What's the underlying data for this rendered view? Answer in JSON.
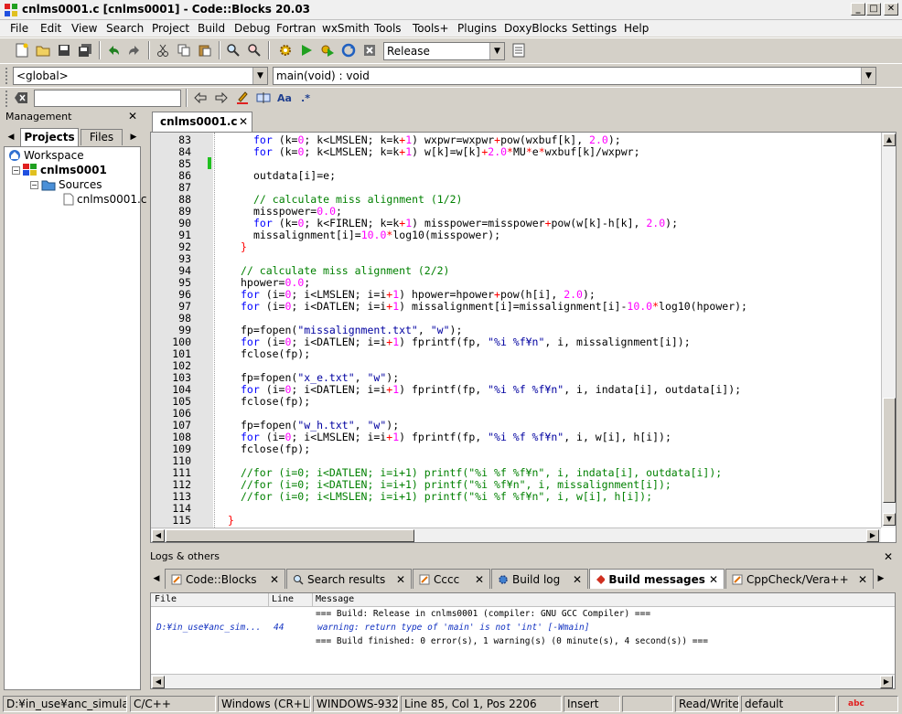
{
  "window": {
    "title": "cnlms0001.c [cnlms0001] - Code::Blocks 20.03",
    "min_glyph": "_",
    "max_glyph": "□",
    "close_glyph": "✕"
  },
  "menu": [
    "File",
    "Edit",
    "View",
    "Search",
    "Project",
    "Build",
    "Debug",
    "Fortran",
    "wxSmith",
    "Tools",
    "Tools+",
    "Plugins",
    "DoxyBlocks",
    "Settings",
    "Help"
  ],
  "toolbar": {
    "build_target": "Release",
    "scope": "<global>",
    "function": "main(void) : void",
    "search_value": ""
  },
  "management": {
    "title": "Management",
    "tabs": [
      "Projects",
      "Files"
    ],
    "tree": {
      "workspace": "Workspace",
      "project": "cnlms0001",
      "folder": "Sources",
      "file": "cnlms0001.c"
    }
  },
  "editor": {
    "tab": "cnlms0001.c",
    "lines": [
      {
        "n": "83",
        "indent": 2,
        "parts": [
          [
            "kw",
            "for"
          ],
          [
            "t",
            " (k="
          ],
          [
            "num",
            "0"
          ],
          [
            "t",
            "; k<LMSLEN; k=k"
          ],
          [
            "op",
            "+"
          ],
          [
            "num",
            "1"
          ],
          [
            "t",
            ") wxpwr=wxpwr"
          ],
          [
            "op",
            "+"
          ],
          [
            "t",
            "pow(wxbuf[k], "
          ],
          [
            "num",
            "2.0"
          ],
          [
            "t",
            ");"
          ]
        ]
      },
      {
        "n": "84",
        "indent": 2,
        "parts": [
          [
            "kw",
            "for"
          ],
          [
            "t",
            " (k="
          ],
          [
            "num",
            "0"
          ],
          [
            "t",
            "; k<LMSLEN; k=k"
          ],
          [
            "op",
            "+"
          ],
          [
            "num",
            "1"
          ],
          [
            "t",
            ") w[k]=w[k]"
          ],
          [
            "op",
            "+"
          ],
          [
            "num",
            "2.0"
          ],
          [
            "op",
            "*"
          ],
          [
            "t",
            "MU"
          ],
          [
            "op",
            "*"
          ],
          [
            "t",
            "e"
          ],
          [
            "op",
            "*"
          ],
          [
            "t",
            "wxbuf[k]/wxpwr;"
          ]
        ]
      },
      {
        "n": "85",
        "indent": 2,
        "parts": []
      },
      {
        "n": "86",
        "indent": 2,
        "parts": [
          [
            "t",
            "outdata[i]=e;"
          ]
        ]
      },
      {
        "n": "87",
        "indent": 2,
        "parts": []
      },
      {
        "n": "88",
        "indent": 2,
        "parts": [
          [
            "cm",
            "// calculate miss alignment (1/2)"
          ]
        ]
      },
      {
        "n": "89",
        "indent": 2,
        "parts": [
          [
            "t",
            "misspower="
          ],
          [
            "num",
            "0.0"
          ],
          [
            "t",
            ";"
          ]
        ]
      },
      {
        "n": "90",
        "indent": 2,
        "parts": [
          [
            "kw",
            "for"
          ],
          [
            "t",
            " (k="
          ],
          [
            "num",
            "0"
          ],
          [
            "t",
            "; k<FIRLEN; k=k"
          ],
          [
            "op",
            "+"
          ],
          [
            "num",
            "1"
          ],
          [
            "t",
            ") misspower=misspower"
          ],
          [
            "op",
            "+"
          ],
          [
            "t",
            "pow(w[k]-h[k], "
          ],
          [
            "num",
            "2.0"
          ],
          [
            "t",
            ");"
          ]
        ]
      },
      {
        "n": "91",
        "indent": 2,
        "parts": [
          [
            "t",
            "missalignment[i]="
          ],
          [
            "num",
            "10.0"
          ],
          [
            "op",
            "*"
          ],
          [
            "t",
            "log10(misspower);"
          ]
        ]
      },
      {
        "n": "92",
        "indent": 1,
        "parts": [
          [
            "op",
            "}"
          ]
        ]
      },
      {
        "n": "93",
        "indent": 1,
        "parts": []
      },
      {
        "n": "94",
        "indent": 1,
        "parts": [
          [
            "cm",
            "// calculate miss alignment (2/2)"
          ]
        ]
      },
      {
        "n": "95",
        "indent": 1,
        "parts": [
          [
            "t",
            "hpower="
          ],
          [
            "num",
            "0.0"
          ],
          [
            "t",
            ";"
          ]
        ]
      },
      {
        "n": "96",
        "indent": 1,
        "parts": [
          [
            "kw",
            "for"
          ],
          [
            "t",
            " (i="
          ],
          [
            "num",
            "0"
          ],
          [
            "t",
            "; i<LMSLEN; i=i"
          ],
          [
            "op",
            "+"
          ],
          [
            "num",
            "1"
          ],
          [
            "t",
            ") hpower=hpower"
          ],
          [
            "op",
            "+"
          ],
          [
            "t",
            "pow(h[i], "
          ],
          [
            "num",
            "2.0"
          ],
          [
            "t",
            ");"
          ]
        ]
      },
      {
        "n": "97",
        "indent": 1,
        "parts": [
          [
            "kw",
            "for"
          ],
          [
            "t",
            " (i="
          ],
          [
            "num",
            "0"
          ],
          [
            "t",
            "; i<DATLEN; i=i"
          ],
          [
            "op",
            "+"
          ],
          [
            "num",
            "1"
          ],
          [
            "t",
            ") missalignment[i]=missalignment[i]-"
          ],
          [
            "num",
            "10.0"
          ],
          [
            "op",
            "*"
          ],
          [
            "t",
            "log10(hpower);"
          ]
        ]
      },
      {
        "n": "98",
        "indent": 1,
        "parts": []
      },
      {
        "n": "99",
        "indent": 1,
        "parts": [
          [
            "t",
            "fp=fopen("
          ],
          [
            "str",
            "\"missalignment.txt\""
          ],
          [
            "t",
            ", "
          ],
          [
            "str",
            "\"w\""
          ],
          [
            "t",
            ");"
          ]
        ]
      },
      {
        "n": "100",
        "indent": 1,
        "parts": [
          [
            "kw",
            "for"
          ],
          [
            "t",
            " (i="
          ],
          [
            "num",
            "0"
          ],
          [
            "t",
            "; i<DATLEN; i=i"
          ],
          [
            "op",
            "+"
          ],
          [
            "num",
            "1"
          ],
          [
            "t",
            ") fprintf(fp, "
          ],
          [
            "str",
            "\"%i %f¥n\""
          ],
          [
            "t",
            ", i, missalignment[i]);"
          ]
        ]
      },
      {
        "n": "101",
        "indent": 1,
        "parts": [
          [
            "t",
            "fclose(fp);"
          ]
        ]
      },
      {
        "n": "102",
        "indent": 1,
        "parts": []
      },
      {
        "n": "103",
        "indent": 1,
        "parts": [
          [
            "t",
            "fp=fopen("
          ],
          [
            "str",
            "\"x_e.txt\""
          ],
          [
            "t",
            ", "
          ],
          [
            "str",
            "\"w\""
          ],
          [
            "t",
            ");"
          ]
        ]
      },
      {
        "n": "104",
        "indent": 1,
        "parts": [
          [
            "kw",
            "for"
          ],
          [
            "t",
            " (i="
          ],
          [
            "num",
            "0"
          ],
          [
            "t",
            "; i<DATLEN; i=i"
          ],
          [
            "op",
            "+"
          ],
          [
            "num",
            "1"
          ],
          [
            "t",
            ") fprintf(fp, "
          ],
          [
            "str",
            "\"%i %f %f¥n\""
          ],
          [
            "t",
            ", i, indata[i], outdata[i]);"
          ]
        ]
      },
      {
        "n": "105",
        "indent": 1,
        "parts": [
          [
            "t",
            "fclose(fp);"
          ]
        ]
      },
      {
        "n": "106",
        "indent": 1,
        "parts": []
      },
      {
        "n": "107",
        "indent": 1,
        "parts": [
          [
            "t",
            "fp=fopen("
          ],
          [
            "str",
            "\"w_h.txt\""
          ],
          [
            "t",
            ", "
          ],
          [
            "str",
            "\"w\""
          ],
          [
            "t",
            ");"
          ]
        ]
      },
      {
        "n": "108",
        "indent": 1,
        "parts": [
          [
            "kw",
            "for"
          ],
          [
            "t",
            " (i="
          ],
          [
            "num",
            "0"
          ],
          [
            "t",
            "; i<LMSLEN; i=i"
          ],
          [
            "op",
            "+"
          ],
          [
            "num",
            "1"
          ],
          [
            "t",
            ") fprintf(fp, "
          ],
          [
            "str",
            "\"%i %f %f¥n\""
          ],
          [
            "t",
            ", i, w[i], h[i]);"
          ]
        ]
      },
      {
        "n": "109",
        "indent": 1,
        "parts": [
          [
            "t",
            "fclose(fp);"
          ]
        ]
      },
      {
        "n": "110",
        "indent": 1,
        "parts": []
      },
      {
        "n": "111",
        "indent": 1,
        "parts": [
          [
            "cm",
            "//for (i=0; i<DATLEN; i=i+1) printf(\"%i %f %f¥n\", i, indata[i], outdata[i]);"
          ]
        ]
      },
      {
        "n": "112",
        "indent": 1,
        "parts": [
          [
            "cm",
            "//for (i=0; i<DATLEN; i=i+1) printf(\"%i %f¥n\", i, missalignment[i]);"
          ]
        ]
      },
      {
        "n": "113",
        "indent": 1,
        "parts": [
          [
            "cm",
            "//for (i=0; i<LMSLEN; i=i+1) printf(\"%i %f %f¥n\", i, w[i], h[i]);"
          ]
        ]
      },
      {
        "n": "114",
        "indent": 1,
        "parts": []
      },
      {
        "n": "115",
        "indent": 0,
        "parts": [
          [
            "op",
            "}"
          ]
        ]
      }
    ]
  },
  "logs": {
    "title": "Logs & others",
    "tabs": [
      "Code::Blocks",
      "Search results",
      "Cccc",
      "Build log",
      "Build messages",
      "CppCheck/Vera++"
    ],
    "active_tab": "Build messages",
    "columns": [
      "File",
      "Line",
      "Message"
    ],
    "rows": [
      {
        "file": "",
        "line": "",
        "message": "=== Build: Release in cnlms0001 (compiler: GNU GCC Compiler) ==="
      },
      {
        "file": "D:¥in_use¥anc_sim...",
        "line": "44",
        "message": "warning: return type of 'main' is not 'int' [-Wmain]"
      },
      {
        "file": "",
        "line": "",
        "message": "=== Build finished: 0 error(s), 1 warning(s) (0 minute(s), 4 second(s)) ==="
      }
    ]
  },
  "statusbar": {
    "path": "D:¥in_use¥anc_simulatio...",
    "language": "C/C++",
    "eol": "Windows (CR+LF)",
    "encoding": "WINDOWS-932",
    "position": "Line 85, Col 1, Pos 2206",
    "mode": "Insert",
    "access": "Read/Write",
    "theme": "default"
  }
}
